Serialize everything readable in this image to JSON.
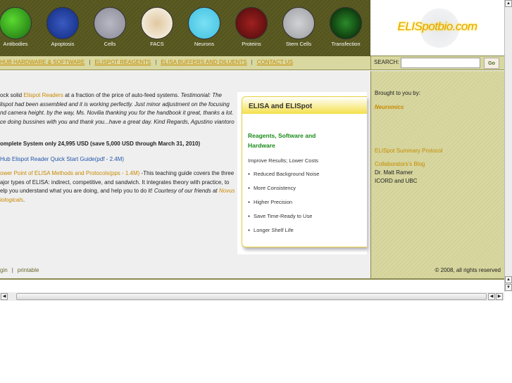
{
  "header": {
    "thumbs": [
      {
        "label": "Antibodies",
        "color": "#2a9a20"
      },
      {
        "label": "Apoptosis",
        "color": "#1a3a9a"
      },
      {
        "label": "Cells",
        "color": "#9a9aa8"
      },
      {
        "label": "FACS",
        "color": "#f4efe2"
      },
      {
        "label": "Neurons",
        "color": "#5ad0ea"
      },
      {
        "label": "Proteins",
        "color": "#7a1a1a"
      },
      {
        "label": "Stem Cells",
        "color": "#b4b6b8"
      },
      {
        "label": "Transfection",
        "color": "#0a3a0a"
      }
    ],
    "logo": "ELISpotbio.com"
  },
  "nav": {
    "items": [
      "HUB HARDWARE & SOFTWARE",
      "ELISPOT REAGENTS",
      "ELISA BUFFERS AND DILUENTS",
      "CONTACT US"
    ],
    "sep": "|"
  },
  "search": {
    "label": "SEARCH:",
    "value": "",
    "button": "Go"
  },
  "main": {
    "p1_pre": "ock solid ",
    "p1_link": "Elispot Readers",
    "p1_post": " at a fraction of the price of auto-feed systems. ",
    "p1_testimonial": "Testimonial:  The lispot had been assembled and it is working perfectly. Just minor adjustment on the focusing nd camera height. by the way, Ms. Novilia thanking you for the handbook it great, thanks a lot. ce doing bussines with you and thank you...have a great day. Kind Regards, Agustino viantoro",
    "price": "omplete System only 24,995 USD (save 5,000 USD through March 31, 2010)",
    "guide_link": "Hub Elispot Reader Quick Start Guide(pdf - 2.4M)",
    "pp_link": "ower Point of ELISA Methods and Protocols(pps - 1.4M)",
    "pp_text": " -This teaching guide covers the three ajor types of ELISA: indirect, competitive, and sandwich. It integrates theory with practice, to elp you understand what you are doing, and help you to do it! ",
    "pp_courtesy": "Courtesy of our friends at ",
    "pp_novus": "Novus iologicals",
    "login": "gin",
    "footer_sep": "|",
    "printable": "printable"
  },
  "promo": {
    "title": "ELISA and ELISpot",
    "subtitle": "Reagents, Software and Hardware",
    "tagline": "Improve Results; Lower Costs",
    "bullets": [
      "Reduced Background Noise",
      "More Consistency",
      "Higher Precision",
      "Save Time-Ready to Use",
      "Longer Shelf Life"
    ]
  },
  "side": {
    "brought": "Brought to you by:",
    "neuromics": "Neuromics",
    "protocol": "ELISpot Summary Protocol",
    "blog": "Collaborators's Blog",
    "name": "Dr. Matt Ramer",
    "org": "ICORD and UBC",
    "copyright": "© 2008, all rights reserved"
  },
  "scroll": {
    "up": "▲",
    "down": "▼",
    "left": "◀",
    "right": "▶"
  }
}
